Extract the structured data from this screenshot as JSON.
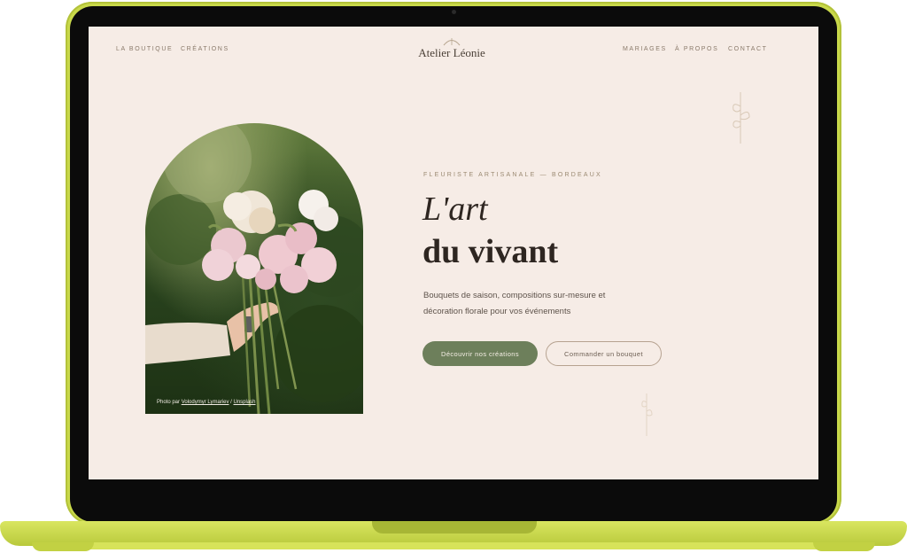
{
  "nav": {
    "left": [
      "LA BOUTIQUE",
      "CRÉATIONS"
    ],
    "right": [
      "MARIAGES",
      "À PROPOS",
      "CONTACT"
    ],
    "logo": "Atelier Léonie"
  },
  "hero": {
    "eyebrow": "FLEURISTE ARTISANALE — BORDEAUX",
    "title_line1": "L'art",
    "title_line2": "du vivant",
    "lead_line1": "Bouquets de saison, compositions sur-mesure et",
    "lead_line2": "décoration florale pour vos événements",
    "primary_button": "Découvrir nos créations",
    "secondary_button": "Commander un bouquet",
    "photo_credit_prefix": "Photo par ",
    "photo_credit_author": "Volodymyr Lymariev",
    "photo_credit_sep": " / ",
    "photo_credit_source": "Unsplash"
  },
  "colors": {
    "device": "#c9d94a",
    "page_bg": "#f6ece6",
    "accent_green": "#6d7f5b",
    "text_dark": "#2e2621"
  },
  "icons": [
    "logo-leaf-icon",
    "botanical-sprig-icon",
    "bouquet-photo"
  ]
}
